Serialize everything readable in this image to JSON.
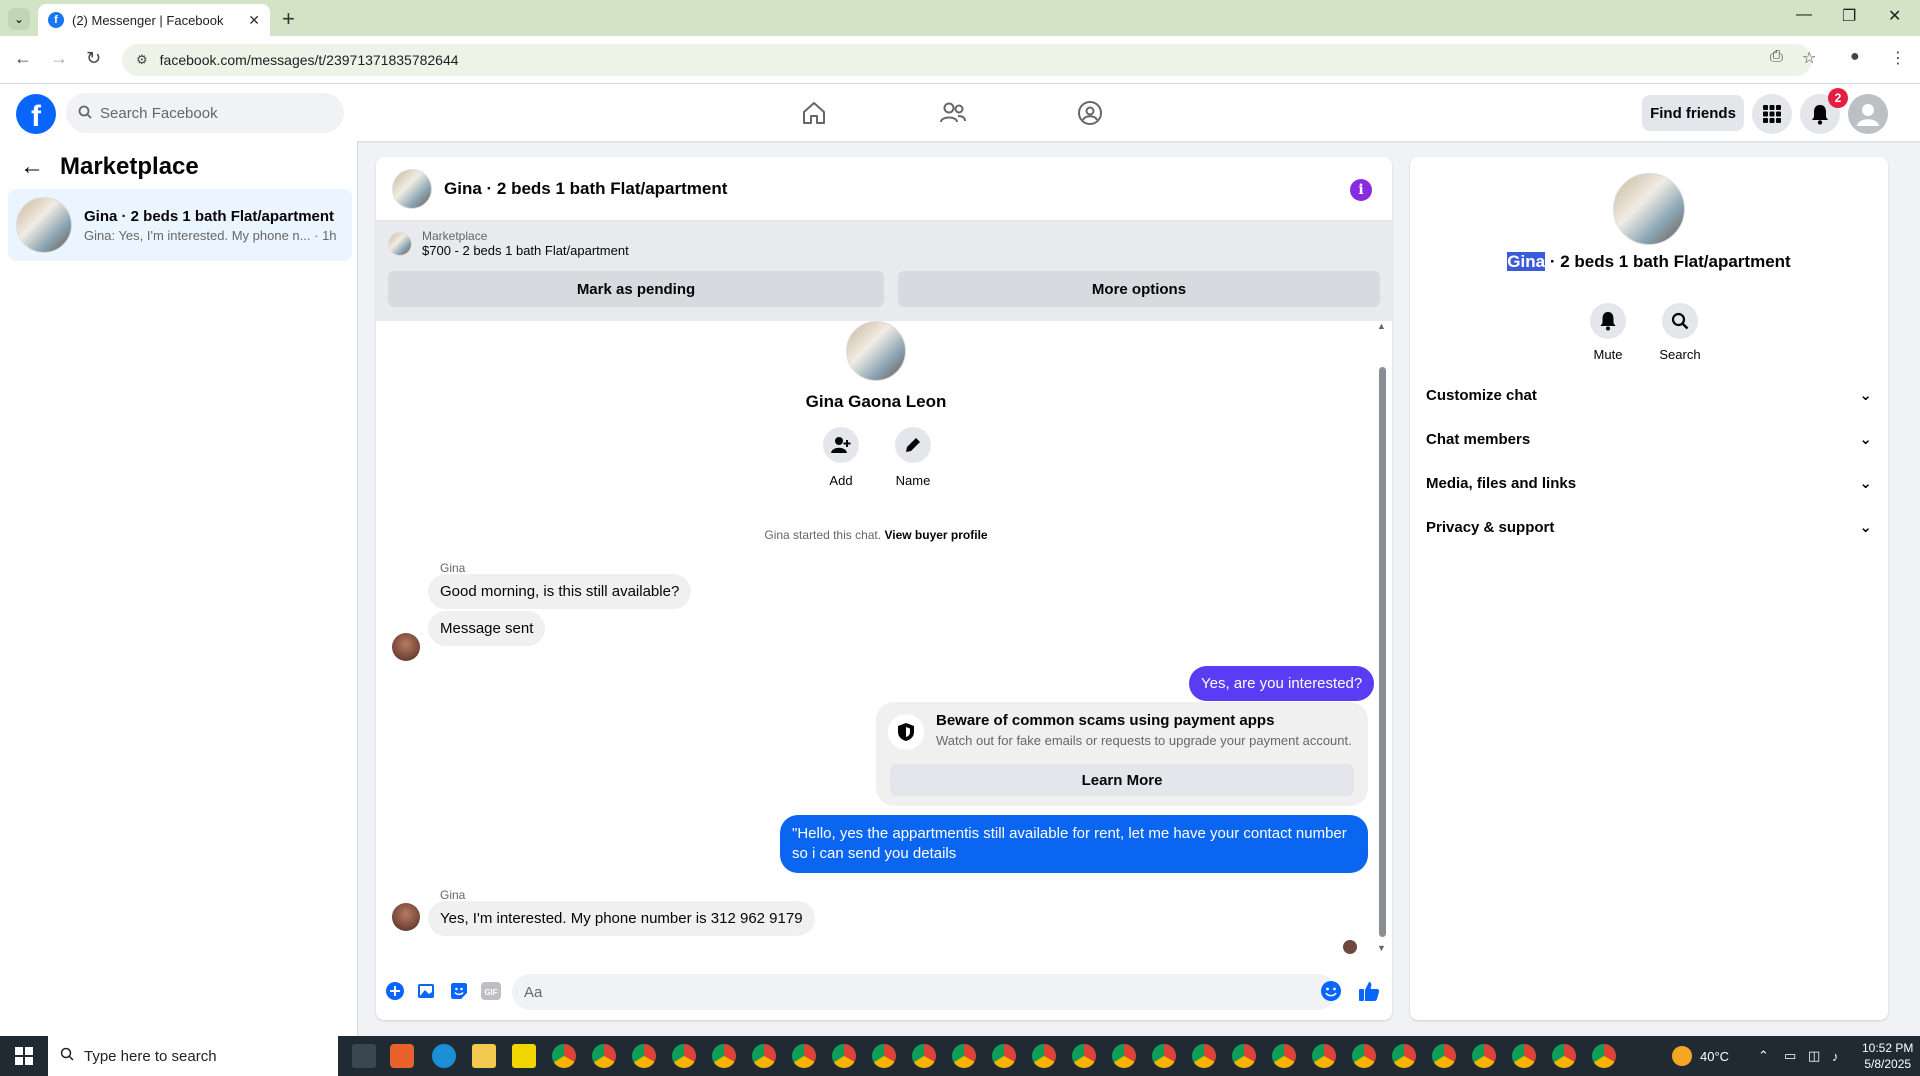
{
  "browser": {
    "tab_title": "(2) Messenger | Facebook",
    "url": "facebook.com/messages/t/23971371835782644"
  },
  "header": {
    "search_placeholder": "Search Facebook",
    "find_friends": "Find friends",
    "notification_count": "2"
  },
  "sidebar": {
    "title": "Marketplace",
    "conversation": {
      "title": "Gina · 2 beds 1 bath Flat/apartment",
      "preview": "Gina: Yes, I'm interested. My phone n...",
      "time": "· 1h"
    }
  },
  "chat": {
    "title": "Gina · 2 beds 1 bath Flat/apartment",
    "listing_category": "Marketplace",
    "listing_name": "$700 - 2 beds 1 bath Flat/apartment",
    "mark_pending": "Mark as pending",
    "more_options": "More options",
    "profile_name": "Gina Gaona Leon",
    "add_label": "Add",
    "name_label": "Name",
    "started_text": "Gina started this chat.",
    "view_buyer": "View buyer profile",
    "sender": "Gina",
    "msg1": "Good morning, is this still available?",
    "msg2": "Message sent",
    "msg3": "Yes, are you interested?",
    "scam_title": "Beware of common scams using payment apps",
    "scam_sub": "Watch out for fake emails or requests to upgrade your payment account.",
    "learn_more": "Learn More",
    "msg4": "\"Hello, yes the appartmentis still available for rent, let me have your contact number so i can send you details",
    "msg5": "Yes, I'm interested. My phone number is 312 962 9179",
    "composer_placeholder": "Aa"
  },
  "details": {
    "title_highlight": "Gina",
    "title_rest": " · 2 beds 1 bath Flat/apartment",
    "mute": "Mute",
    "search": "Search",
    "sections": [
      "Customize chat",
      "Chat members",
      "Media, files and links",
      "Privacy & support"
    ]
  },
  "taskbar": {
    "search_placeholder": "Type here to search",
    "temperature": "40°C",
    "time": "10:52 PM",
    "date": "5/8/2025"
  },
  "colors": {
    "fb_blue": "#0866ff",
    "outgoing_purple": "#5b3cf5",
    "outgoing_blue": "#0a66f0",
    "badge_red": "#e41e3f"
  }
}
